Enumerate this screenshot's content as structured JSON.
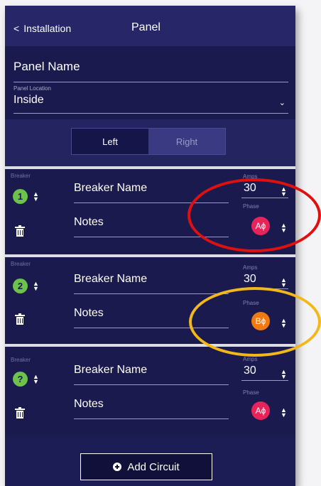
{
  "header": {
    "back_label": "Installation",
    "title": "Panel"
  },
  "panel": {
    "name_label": "Panel Name",
    "location_label": "Panel Location",
    "location_value": "Inside"
  },
  "side_toggle": {
    "left": "Left",
    "right": "Right",
    "selected": "Left"
  },
  "breakers": [
    {
      "label": "Breaker",
      "number": "1",
      "name": "Breaker Name",
      "notes": "Notes",
      "amps_label": "Amps",
      "amps": "30",
      "phase_label": "Phase",
      "phase": "Aϕ",
      "phase_color": "#e8235a"
    },
    {
      "label": "Breaker",
      "number": "2",
      "name": "Breaker Name",
      "notes": "Notes",
      "amps_label": "Amps",
      "amps": "30",
      "phase_label": "Phase",
      "phase": "Bϕ",
      "phase_color": "#f07a10"
    },
    {
      "label": "Breaker",
      "number": "?",
      "name": "Breaker Name",
      "notes": "Notes",
      "amps_label": "Amps",
      "amps": "30",
      "phase_label": "Phase",
      "phase": "Aϕ",
      "phase_color": "#e8235a"
    }
  ],
  "add_button": {
    "label": "Add Circuit"
  },
  "colors": {
    "background": "#1a1a4e",
    "breaker_badge": "#6cc24a",
    "annotation_red": "#e01010",
    "annotation_yellow": "#f2b81a"
  }
}
